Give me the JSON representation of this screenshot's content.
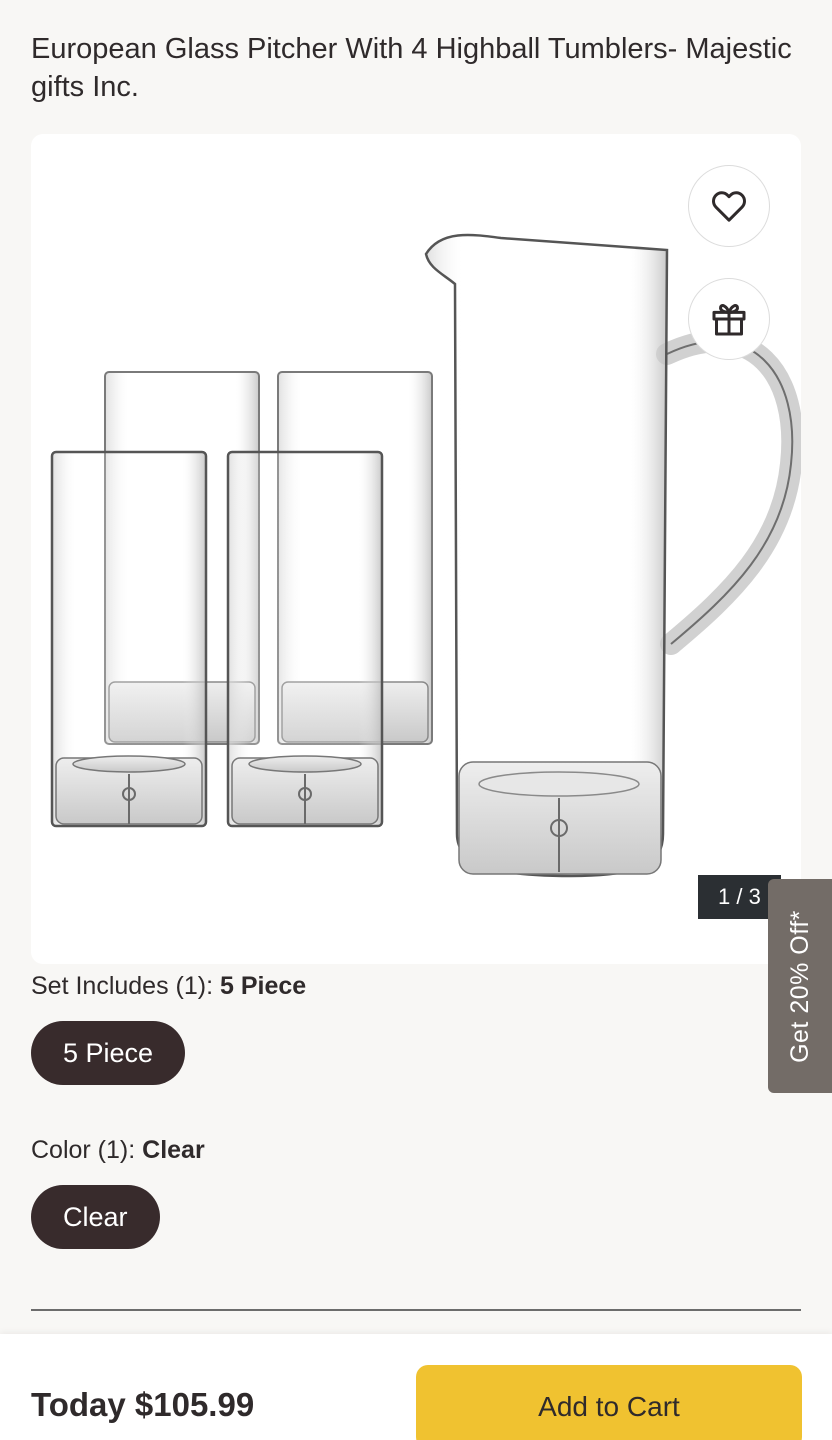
{
  "product": {
    "title": "European Glass Pitcher With 4 Highball Tumblers- Majestic gifts Inc."
  },
  "gallery": {
    "counter": "1 / 3",
    "wishlist_icon": "heart-icon",
    "gift_icon": "gift-icon"
  },
  "promo": {
    "tab_label": "Get 20% Off*"
  },
  "options": {
    "set": {
      "label": "Set Includes (1):",
      "selected": "5 Piece",
      "choices": [
        "5 Piece"
      ]
    },
    "color": {
      "label": "Color (1):",
      "selected": "Clear",
      "choices": [
        "Clear"
      ]
    }
  },
  "purchase": {
    "price": "Today $105.99",
    "add_to_cart": "Add to Cart"
  },
  "colors": {
    "pill_bg": "#382b2c",
    "cart_button": "#f0c230",
    "promo_tab": "#736c67",
    "counter_bg": "#2b2f33"
  }
}
